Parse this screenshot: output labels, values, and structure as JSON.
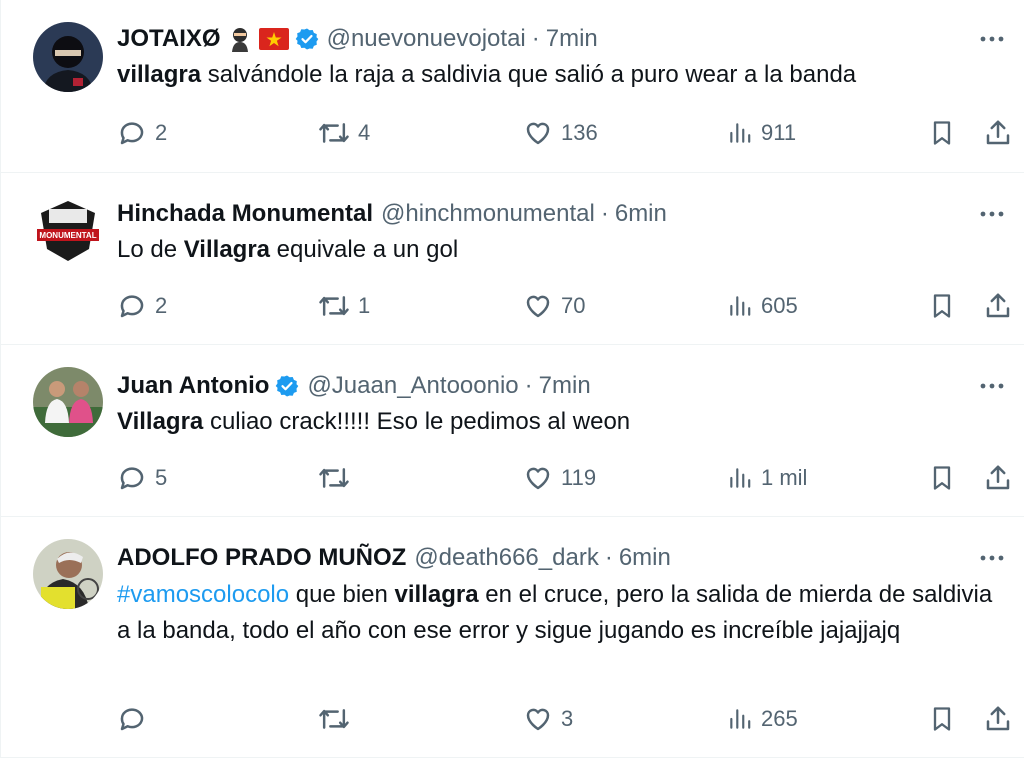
{
  "tweets": [
    {
      "name": "JOTAIXØ",
      "emojis": [
        "ninja-emoji",
        "vietnam-flag-emoji"
      ],
      "verified": true,
      "handle": "@nuevonuevojotai",
      "separator": "·",
      "time": "7min",
      "segments": [
        {
          "t": "villagra",
          "style": "bold"
        },
        {
          "t": " salvándole la raja a saldivia que salió a puro wear a la banda",
          "style": "normal"
        }
      ],
      "replies": "2",
      "retweets": "4",
      "likes": "136",
      "views": "911"
    },
    {
      "name": "Hinchada Monumental",
      "emojis": [],
      "verified": false,
      "handle": "@hinchmonumental",
      "separator": "·",
      "time": "6min",
      "segments": [
        {
          "t": "Lo de ",
          "style": "normal"
        },
        {
          "t": "Villagra",
          "style": "bold"
        },
        {
          "t": " equivale a un gol",
          "style": "normal"
        }
      ],
      "replies": "2",
      "retweets": "1",
      "likes": "70",
      "views": "605"
    },
    {
      "name": "Juan Antonio",
      "emojis": [],
      "verified": true,
      "handle": "@Juaan_Antooonio",
      "separator": "·",
      "time": "7min",
      "segments": [
        {
          "t": "Villagra",
          "style": "bold"
        },
        {
          "t": " culiao crack!!!!! Eso le pedimos al weon",
          "style": "normal"
        }
      ],
      "replies": "5",
      "retweets": "",
      "likes": "119",
      "views": "1 mil"
    },
    {
      "name": "ADOLFO PRADO MUÑOZ",
      "emojis": [],
      "verified": false,
      "handle": "@death666_dark",
      "separator": "·",
      "time": "6min",
      "segments": [
        {
          "t": "#vamoscolocolo",
          "style": "hashtag"
        },
        {
          "t": " que bien ",
          "style": "normal"
        },
        {
          "t": "villagra",
          "style": "bold"
        },
        {
          "t": " en el cruce, pero la salida de mierda de saldivia a la banda, todo el año con ese error y sigue jugando es increíble jajajjajq",
          "style": "normal"
        }
      ],
      "replies": "",
      "retweets": "",
      "likes": "3",
      "views": "265"
    }
  ],
  "avatar_text": {
    "t1": "",
    "t2": "MONUMENTAL",
    "t3": "",
    "t4": ""
  },
  "colors": {
    "text_primary": "#0f1419",
    "text_secondary": "#536471",
    "hashtag": "#1d9bf0",
    "verified": "#1d9bf0",
    "divider": "#eff3f4"
  }
}
